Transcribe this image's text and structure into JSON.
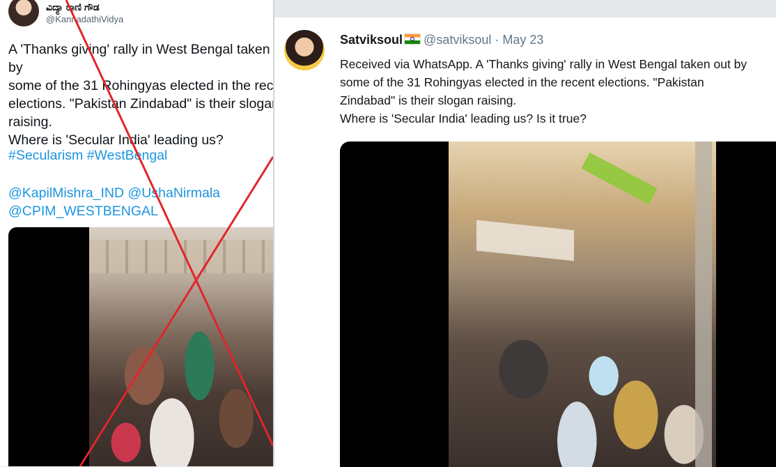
{
  "left_tweet": {
    "author_name": "ವಿದ್ಯಾ ರಾಣಿ ಗೌಡ",
    "author_handle": "@KannadathiVidya",
    "text": "A 'Thanks giving' rally in West Bengal taken out by\nsome of the 31 Rohingyas elected in the recent\nelections. \"Pakistan Zindabad\" is their slogan\nraising.\nWhere is 'Secular India' leading us?",
    "hashtags": "#Secularism #WestBengal",
    "mentions": "@KapilMishra_IND @UshaNirmala\n@CPIM_WESTBENGAL",
    "cross_mark": "red-x-icon",
    "cross_color": "#e0262a"
  },
  "right_tweet": {
    "author_name": "Satviksoul",
    "flag_icon": "india-flag-icon",
    "author_handle": "@satviksoul",
    "separator": "·",
    "date": "May 23",
    "text": "Received via WhatsApp. A 'Thanks giving' rally in West Bengal taken out by\nsome of the 31 Rohingyas elected in the recent elections. \"Pakistan\nZindabad\" is their slogan raising.\nWhere is 'Secular India' leading us? Is it true?",
    "link_color": "#1b95e0"
  }
}
